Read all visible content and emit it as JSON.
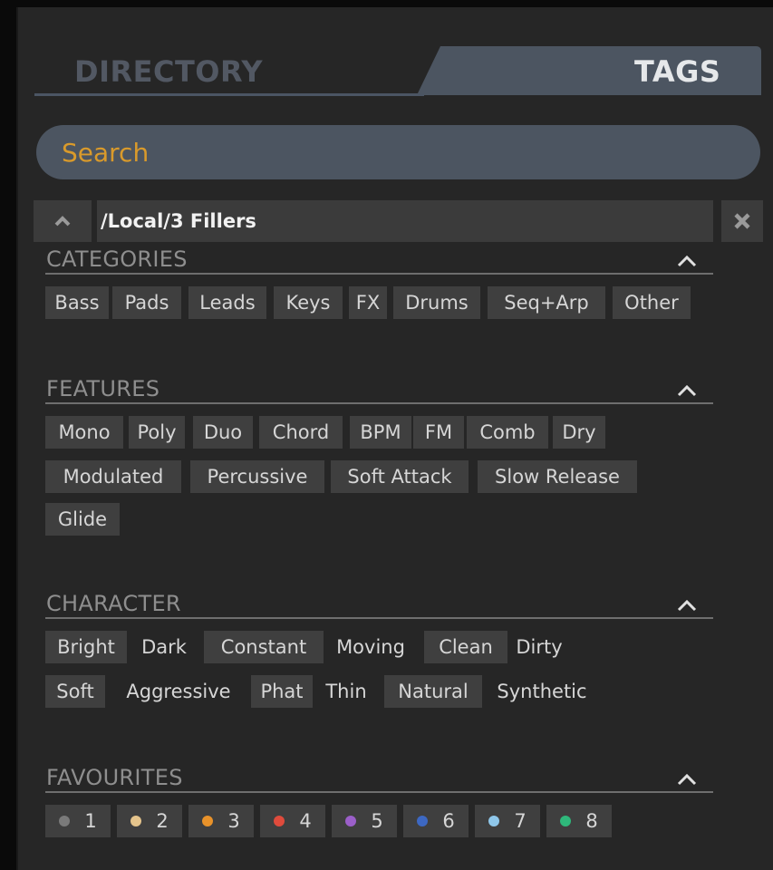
{
  "tabs": {
    "directory": "DIRECTORY",
    "tags": "TAGS"
  },
  "search": {
    "placeholder": "Search"
  },
  "path": {
    "value": "/Local/3 Fillers"
  },
  "icons": {
    "up": "chevron-up-icon",
    "close": "close-icon",
    "collapse": "chevron-up-icon"
  },
  "colors": {
    "accent": "#d99a2b",
    "tab_active": "#4c5561"
  },
  "categories": {
    "title": "CATEGORIES",
    "tags": [
      "Bass",
      "Pads",
      "Leads",
      "Keys",
      "FX",
      "Drums",
      "Seq+Arp",
      "Other"
    ]
  },
  "features": {
    "title": "FEATURES",
    "rows": [
      [
        "Mono",
        "Poly",
        "Duo",
        "Chord",
        "BPM",
        "FM",
        "Comb",
        "Dry"
      ],
      [
        "Modulated",
        "Percussive",
        "Soft Attack",
        "Slow Release"
      ],
      [
        "Glide"
      ]
    ]
  },
  "character": {
    "title": "CHARACTER",
    "rows": [
      [
        "Bright",
        "Dark",
        "Constant",
        "Moving",
        "Clean",
        "Dirty"
      ],
      [
        "Soft",
        "Aggressive",
        "Phat",
        "Thin",
        "Natural",
        "Synthetic"
      ]
    ]
  },
  "favourites": {
    "title": "FAVOURITES",
    "items": [
      {
        "label": "1",
        "color": "#7a7a7a"
      },
      {
        "label": "2",
        "color": "#e5c48c"
      },
      {
        "label": "3",
        "color": "#e8922a"
      },
      {
        "label": "4",
        "color": "#df4b3c"
      },
      {
        "label": "5",
        "color": "#9b5fc9"
      },
      {
        "label": "6",
        "color": "#3d68c2"
      },
      {
        "label": "7",
        "color": "#8fc7ea"
      },
      {
        "label": "8",
        "color": "#2fb87b"
      }
    ]
  }
}
